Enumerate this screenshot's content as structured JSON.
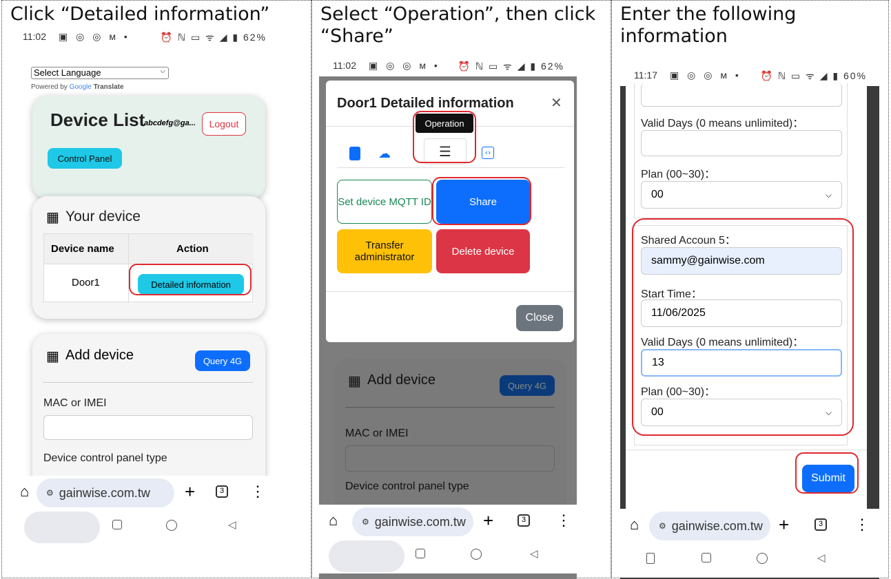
{
  "captions": {
    "p1": "Click “Detailed information”",
    "p2": "Select “Operation”, then click “Share”",
    "p3": "Enter the following information"
  },
  "status": {
    "time1": "11:02",
    "time2": "11:02",
    "time3": "11:17",
    "icons": "▣ ◎ ◎ ᴍ •",
    "right1": "⏰ ℕ ▭ ᯤ ◢ ▮ 62%",
    "right3": "⏰ ℕ ▭ ᯤ ◢ ▮ 60%"
  },
  "panel1": {
    "select_language": "Select Language",
    "powered_by": "Powered by",
    "google": "Google",
    "translate": "Translate",
    "device_list_title": "Device List",
    "email": "abcdefg@ga...",
    "logout": "Logout",
    "control_panel": "Control Panel",
    "your_device": "Your device",
    "col_name": "Device name",
    "col_action": "Action",
    "device": "Door1",
    "detail_btn": "Detailed information",
    "add_device": "Add device",
    "query4g": "Query 4G",
    "mac_label": "MAC or IMEI",
    "type_label": "Device control panel type"
  },
  "panel2": {
    "modal_title": "Door1 Detailed information",
    "close_x": "✕",
    "tooltip": "Operation",
    "set_mqtt": "Set device MQTT ID",
    "share": "Share",
    "transfer": "Transfer administrator",
    "delete": "Delete device",
    "close": "Close",
    "add_device": "Add device",
    "query4g": "Query 4G",
    "mac_label": "MAC or IMEI",
    "type_label": "Device control panel type"
  },
  "panel3": {
    "valid_days": "Valid Days (0 means unlimited)：",
    "plan": "Plan (00~30)：",
    "plan_value": "00",
    "shared_account": "Shared Accoun 5：",
    "email_value": "sammy@gainwise.com",
    "start_time": "Start Time：",
    "start_value": "11/06/2025",
    "valid_days2": "Valid Days (0 means unlimited)：",
    "days_value": "13",
    "plan2": "Plan (00~30)：",
    "plan2_value": "00",
    "submit": "Submit"
  },
  "browser": {
    "url": "gainwise.com.tw",
    "home": "⌂",
    "add": "+",
    "tabs": "3",
    "more": "⋮",
    "sitecfg": "⚙"
  },
  "colors": {
    "cyan": "#1ec8e6",
    "blue": "#0d6efd",
    "red": "#dc3545",
    "yellow": "#ffc107",
    "green": "#198754",
    "gray": "#6c757d",
    "highlight": "#e0282e"
  }
}
